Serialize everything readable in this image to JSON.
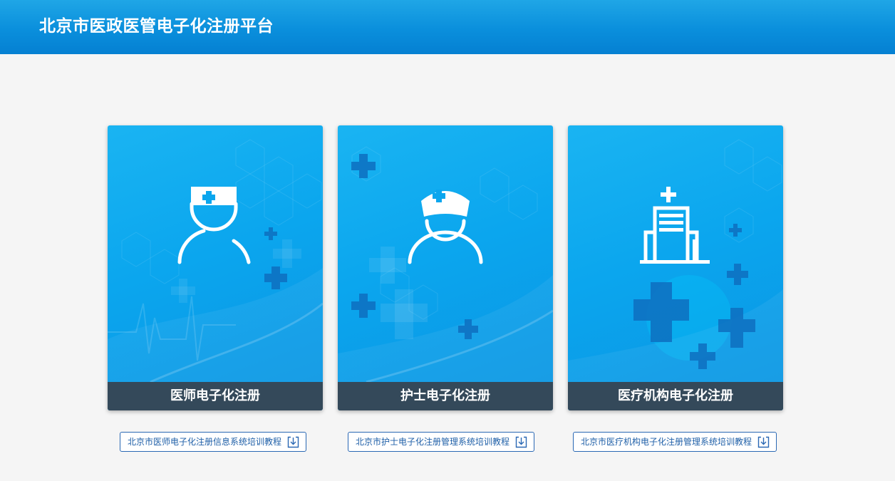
{
  "header": {
    "title": "北京市医政医管电子化注册平台"
  },
  "cards": [
    {
      "label": "医师电子化注册",
      "icon": "doctor-icon"
    },
    {
      "label": "护士电子化注册",
      "icon": "nurse-icon"
    },
    {
      "label": "医疗机构电子化注册",
      "icon": "hospital-icon"
    }
  ],
  "tutorials": [
    {
      "label": "北京市医师电子化注册信息系统培训教程",
      "icon": "download-icon"
    },
    {
      "label": "北京市护士电子化注册管理系统培训教程",
      "icon": "download-icon"
    },
    {
      "label": "北京市医疗机构电子化注册管理系统培训教程",
      "icon": "download-icon"
    }
  ],
  "colors": {
    "header_blue": "#0a8fdc",
    "card_blue": "#0ba6ee",
    "label_bar": "#34495a",
    "link_blue": "#2060a8"
  }
}
